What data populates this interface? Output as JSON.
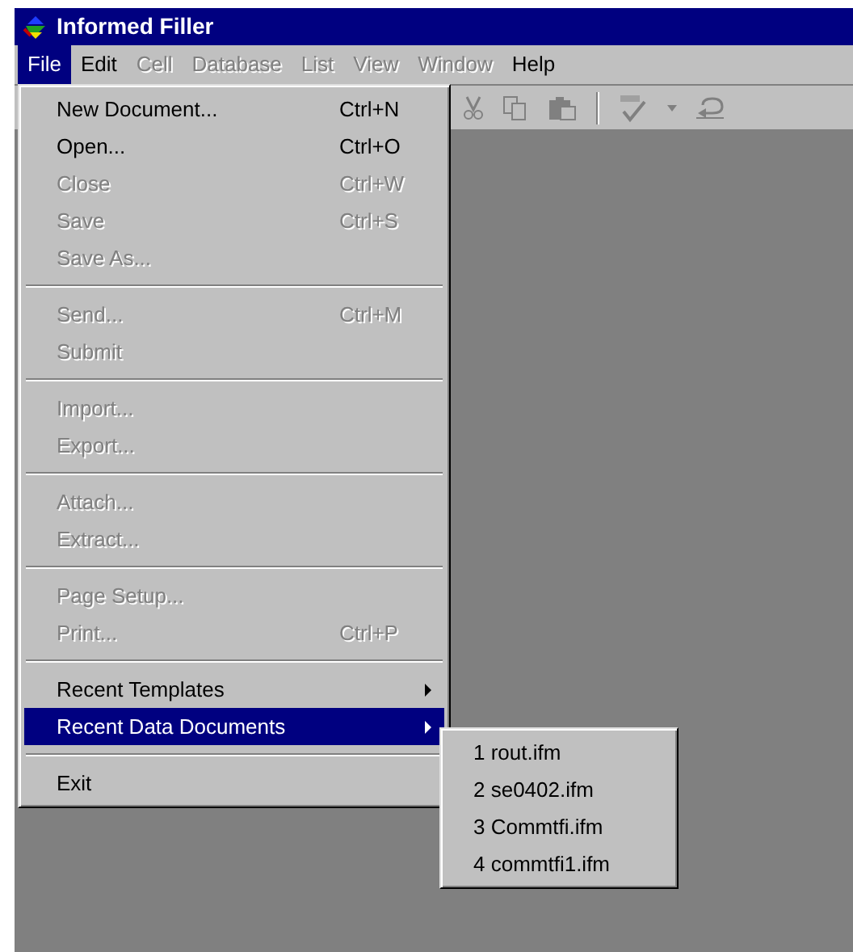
{
  "window": {
    "title": "Informed Filler"
  },
  "menubar": [
    {
      "label": "File",
      "selected": true,
      "disabled": false
    },
    {
      "label": "Edit",
      "selected": false,
      "disabled": false
    },
    {
      "label": "Cell",
      "selected": false,
      "disabled": true
    },
    {
      "label": "Database",
      "selected": false,
      "disabled": true
    },
    {
      "label": "List",
      "selected": false,
      "disabled": true
    },
    {
      "label": "View",
      "selected": false,
      "disabled": true
    },
    {
      "label": "Window",
      "selected": false,
      "disabled": true
    },
    {
      "label": "Help",
      "selected": false,
      "disabled": false
    }
  ],
  "file_menu": [
    {
      "kind": "item",
      "label": "New Document...",
      "shortcut": "Ctrl+N",
      "disabled": false,
      "selected": false
    },
    {
      "kind": "item",
      "label": "Open...",
      "shortcut": "Ctrl+O",
      "disabled": false,
      "selected": false
    },
    {
      "kind": "item",
      "label": "Close",
      "shortcut": "Ctrl+W",
      "disabled": true,
      "selected": false
    },
    {
      "kind": "item",
      "label": "Save",
      "shortcut": "Ctrl+S",
      "disabled": true,
      "selected": false
    },
    {
      "kind": "item",
      "label": "Save As...",
      "disabled": true,
      "selected": false
    },
    {
      "kind": "separator"
    },
    {
      "kind": "item",
      "label": "Send...",
      "shortcut": "Ctrl+M",
      "disabled": true,
      "selected": false
    },
    {
      "kind": "item",
      "label": "Submit",
      "disabled": true,
      "selected": false
    },
    {
      "kind": "separator"
    },
    {
      "kind": "item",
      "label": "Import...",
      "disabled": true,
      "selected": false
    },
    {
      "kind": "item",
      "label": "Export...",
      "disabled": true,
      "selected": false
    },
    {
      "kind": "separator"
    },
    {
      "kind": "item",
      "label": "Attach...",
      "disabled": true,
      "selected": false
    },
    {
      "kind": "item",
      "label": "Extract...",
      "disabled": true,
      "selected": false
    },
    {
      "kind": "separator"
    },
    {
      "kind": "item",
      "label": "Page Setup...",
      "disabled": true,
      "selected": false
    },
    {
      "kind": "item",
      "label": "Print...",
      "shortcut": "Ctrl+P",
      "disabled": true,
      "selected": false
    },
    {
      "kind": "separator"
    },
    {
      "kind": "submenu",
      "label": "Recent Templates",
      "disabled": false,
      "selected": false
    },
    {
      "kind": "submenu",
      "label": "Recent Data Documents",
      "disabled": false,
      "selected": true
    },
    {
      "kind": "separator"
    },
    {
      "kind": "item",
      "label": "Exit",
      "disabled": false,
      "selected": false
    }
  ],
  "recent_data_submenu": [
    "1 rout.ifm",
    "2 se0402.ifm",
    "3 Commtfi.ifm",
    "4 commtfi1.ifm"
  ]
}
